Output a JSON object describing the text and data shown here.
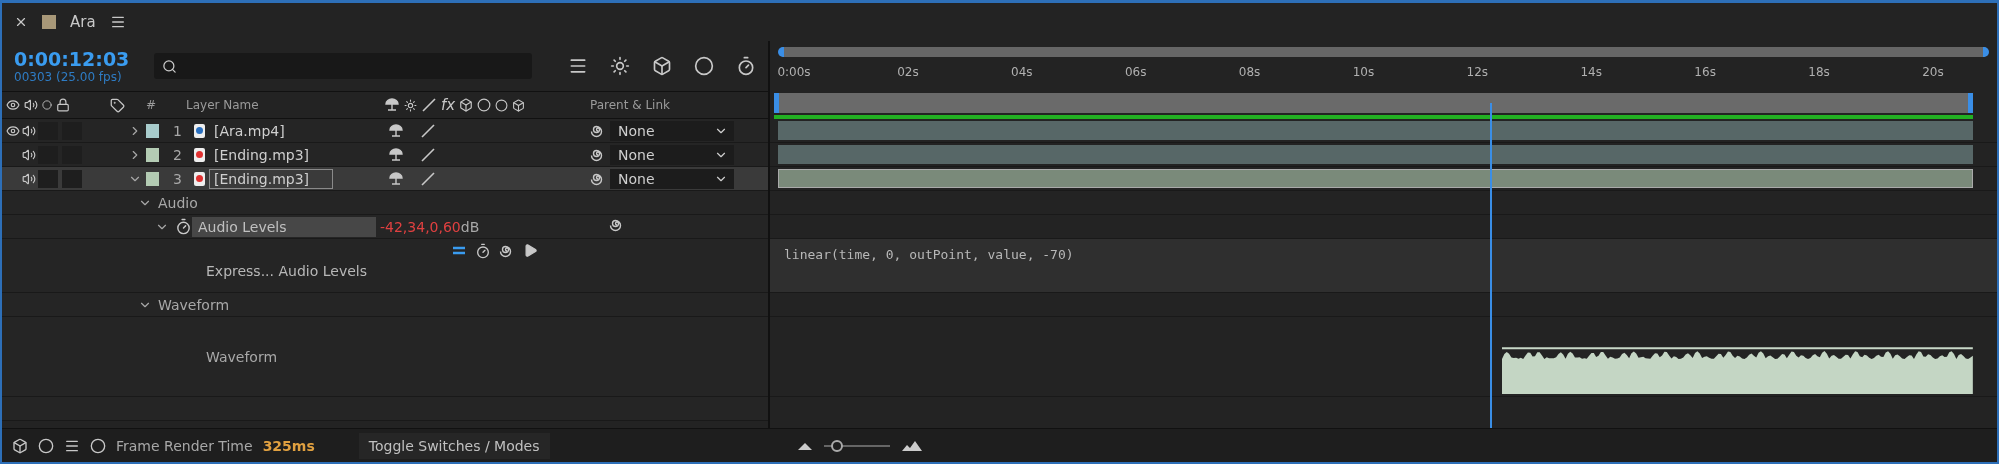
{
  "tab": {
    "title": "Ara",
    "color": "#a89878"
  },
  "header": {
    "timecode": "0:00:12:03",
    "frames": "00303 (25.00 fps)"
  },
  "columns": {
    "number": "#",
    "layer_name": "Layer Name",
    "effects": "fx",
    "parent": "Parent & Link"
  },
  "layers": [
    {
      "number": "1",
      "name": "[Ara.mp4]",
      "kind": "video",
      "video": true,
      "expanded": false,
      "selected": false,
      "parent": "None",
      "color": "#a8cccc"
    },
    {
      "number": "2",
      "name": "[Ending.mp3]",
      "kind": "audio",
      "video": false,
      "expanded": false,
      "selected": false,
      "parent": "None",
      "color": "#b4ccb4"
    },
    {
      "number": "3",
      "name": "[Ending.mp3]",
      "kind": "audio",
      "video": false,
      "expanded": true,
      "selected": true,
      "parent": "None",
      "color": "#b4ccb4"
    }
  ],
  "properties": [
    {
      "kind": "group",
      "name": "Audio",
      "expanded": true
    },
    {
      "kind": "property",
      "name": "Audio Levels",
      "value": "-42,34,0,60",
      "unit": "dB",
      "expanded": true
    },
    {
      "kind": "expression",
      "name": "Express... Audio Levels",
      "expression": "linear(time, 0, outPoint, value, -70)"
    },
    {
      "kind": "group",
      "name": "Waveform",
      "expanded": true
    },
    {
      "kind": "waveform",
      "name": "Waveform"
    }
  ],
  "ruler": [
    "0:00s",
    "02s",
    "04s",
    "06s",
    "08s",
    "10s",
    "12s",
    "14s",
    "16s",
    "18s",
    "20s"
  ],
  "current_time_indicator": {
    "level": 0.606
  },
  "footer": {
    "label": "Frame Render Time",
    "render_time": "325ms",
    "toggle": "Toggle Switches / Modes",
    "zoom": {
      "level": 0.1
    }
  }
}
